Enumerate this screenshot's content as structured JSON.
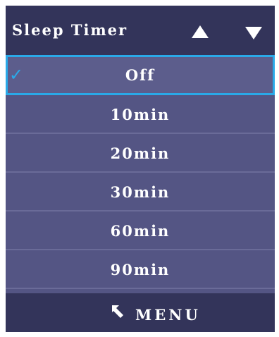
{
  "header": {
    "title": "Sleep Timer",
    "up_icon": "triangle-up",
    "down_icon": "triangle-down"
  },
  "options": [
    {
      "label": "Off",
      "selected": true
    },
    {
      "label": "10min",
      "selected": false
    },
    {
      "label": "20min",
      "selected": false
    },
    {
      "label": "30min",
      "selected": false
    },
    {
      "label": "60min",
      "selected": false
    },
    {
      "label": "90min",
      "selected": false
    }
  ],
  "selection_icon": "checkmark",
  "footer": {
    "icon": "return-arrow",
    "label": "MENU"
  },
  "colors": {
    "header_bg": "#33345a",
    "list_bg": "#545584",
    "selection_border": "#2aa9e8",
    "text": "#ffffff"
  }
}
